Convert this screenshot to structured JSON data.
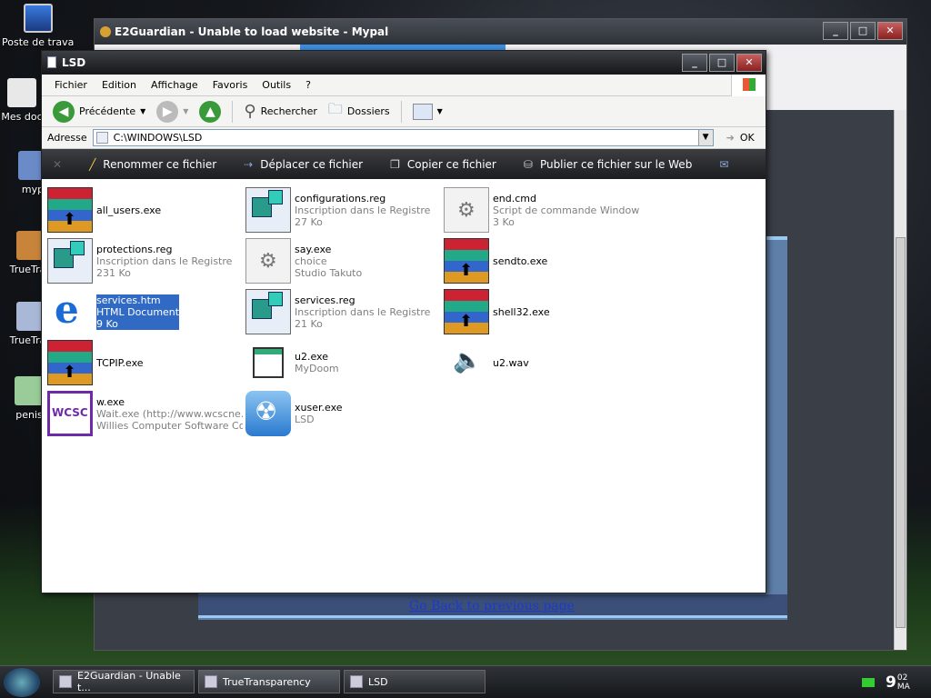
{
  "desktop": {
    "icons": [
      {
        "label": "Poste de travail"
      },
      {
        "label": "Mes doc"
      },
      {
        "label": "myp"
      },
      {
        "label": "TrueTran"
      },
      {
        "label": "TrueTran"
      },
      {
        "label": "penis"
      }
    ]
  },
  "mypal": {
    "title": "E2Guardian - Unable to load website - Mypal",
    "link": "Go Back to previous page"
  },
  "lsd": {
    "title": "LSD",
    "menu": [
      "Fichier",
      "Edition",
      "Affichage",
      "Favoris",
      "Outils",
      "?"
    ],
    "toolbar": {
      "back": "Précédente",
      "search": "Rechercher",
      "folders": "Dossiers"
    },
    "address": {
      "label": "Adresse",
      "value": "C:\\WINDOWS\\LSD",
      "go": "OK"
    },
    "tasks": [
      "Renommer ce fichier",
      "Déplacer ce fichier",
      "Copier ce fichier",
      "Publier ce fichier sur le Web"
    ],
    "files": [
      {
        "name": "all_users.exe",
        "l2": "",
        "l3": "",
        "icon": "rar-icon"
      },
      {
        "name": "configurations.reg",
        "l2": "Inscription dans le Registre",
        "l3": "27 Ko",
        "icon": "registry-icon"
      },
      {
        "name": "end.cmd",
        "l2": "Script de commande Windows NT",
        "l3": "3 Ko",
        "icon": "script-icon"
      },
      {
        "name": "protections.reg",
        "l2": "Inscription dans le Registre",
        "l3": "231 Ko",
        "icon": "registry-icon"
      },
      {
        "name": "say.exe",
        "l2": "choice",
        "l3": "Studio Takuto",
        "icon": "script-icon"
      },
      {
        "name": "sendto.exe",
        "l2": "",
        "l3": "",
        "icon": "rar-icon"
      },
      {
        "name": "services.htm",
        "l2": "HTML Document",
        "l3": "9 Ko",
        "icon": "internet-explorer-icon"
      },
      {
        "name": "services.reg",
        "l2": "Inscription dans le Registre",
        "l3": "21 Ko",
        "icon": "registry-icon"
      },
      {
        "name": "shell32.exe",
        "l2": "",
        "l3": "",
        "icon": "rar-icon"
      },
      {
        "name": "TCPIP.exe",
        "l2": "",
        "l3": "",
        "icon": "rar-icon"
      },
      {
        "name": "u2.exe",
        "l2": "MyDoom",
        "l3": "",
        "icon": "window-icon"
      },
      {
        "name": "u2.wav",
        "l2": "",
        "l3": "",
        "icon": "speaker-icon"
      },
      {
        "name": "w.exe",
        "l2": "Wait.exe (http://www.wcscne...",
        "l3": "Willies Computer Software Co ...",
        "icon": "wcsc-icon"
      },
      {
        "name": "xuser.exe",
        "l2": "LSD",
        "l3": "",
        "icon": "radiation-icon"
      }
    ],
    "selected_file": "services.htm"
  },
  "taskbar": {
    "items": [
      "E2Guardian - Unable t...",
      "TrueTransparency",
      "LSD"
    ],
    "clock_hour": "9",
    "clock_min": "02",
    "clock_ampm": "MA"
  }
}
